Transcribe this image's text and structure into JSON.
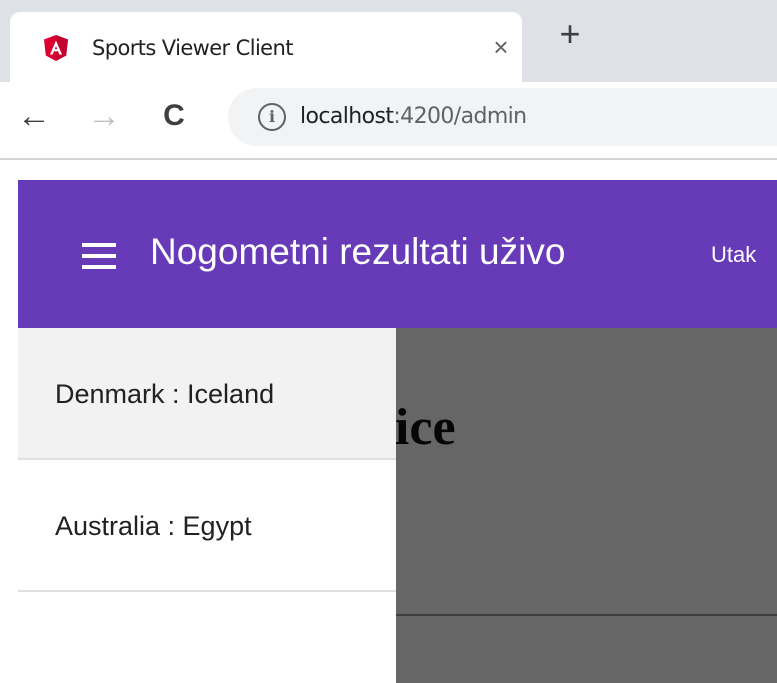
{
  "browser": {
    "tab_title": "Sports Viewer Client",
    "tab_icon": "angular-logo-icon",
    "close_glyph": "×",
    "new_tab_glyph": "+",
    "back_glyph": "←",
    "forward_glyph": "→",
    "reload_glyph": "C",
    "info_glyph": "i",
    "url_host": "localhost",
    "url_rest": ":4200/admin"
  },
  "app": {
    "toolbar_color": "#673ab7",
    "title": "Nogometni rezultati uživo",
    "toolbar_link": "Utak",
    "heading_fragment": "nice"
  },
  "sidenav": {
    "items": [
      {
        "label": "Denmark : Iceland",
        "active": true
      },
      {
        "label": "Australia : Egypt",
        "active": false
      }
    ]
  }
}
